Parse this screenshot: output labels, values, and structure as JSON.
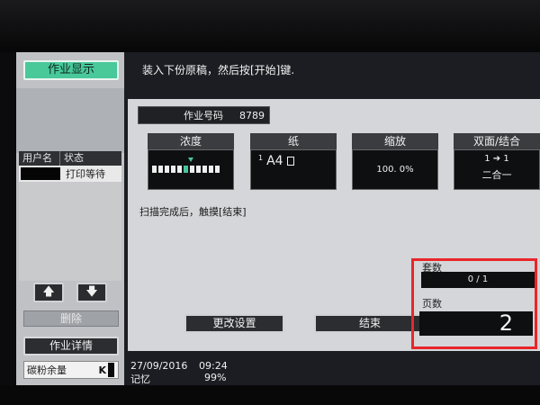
{
  "message": "装入下份原稿，然后按[开始]键.",
  "sidebar": {
    "job_display_label": "作业显示",
    "list_header": {
      "user": "用户名",
      "status": "状态"
    },
    "rows": [
      {
        "user": "",
        "status": "打印等待"
      }
    ],
    "up_icon": "arrow-up-icon",
    "down_icon": "arrow-down-icon",
    "delete_label": "删除",
    "job_detail_label": "作业详情",
    "toner_label": "碳粉余量",
    "toner_color_label": "K"
  },
  "job": {
    "number_label": "作业号码",
    "number_value": "8789"
  },
  "settings": {
    "density": {
      "label": "浓度",
      "level_index": 5,
      "level_count": 11
    },
    "paper": {
      "label": "纸",
      "tray": "1",
      "size": "A4"
    },
    "zoom": {
      "label": "缩放",
      "value": "100. 0%"
    },
    "duplex": {
      "label": "双面/结合",
      "mode": "1 ➔ 1",
      "combine": "二合一"
    }
  },
  "scan_note": "扫描完成后，触摸[结束]",
  "buttons": {
    "change_settings": "更改设置",
    "end": "结束"
  },
  "counters": {
    "copies_label": "套数",
    "copies_value": "0 / 1",
    "pages_label": "页数",
    "pages_value": "2"
  },
  "status": {
    "date": "27/09/2016",
    "time": "09:24",
    "memory_label": "记忆",
    "memory_value": "99%"
  },
  "colors": {
    "accent": "#49c89a",
    "highlight_frame": "#e8262a"
  }
}
